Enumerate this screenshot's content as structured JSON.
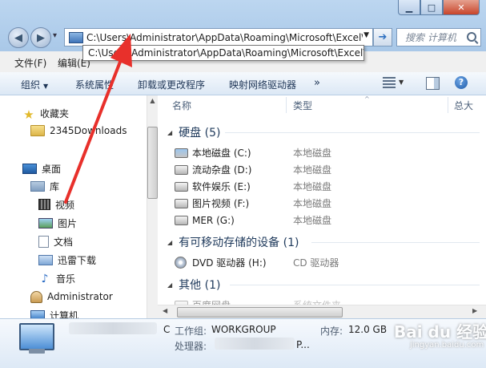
{
  "window": {
    "minimize_glyph": "▁",
    "maximize_glyph": "□",
    "close_glyph": "✕"
  },
  "nav": {
    "back_glyph": "◀",
    "forward_glyph": "▶",
    "recent_glyph": "▾"
  },
  "address": {
    "path": "C:\\Users\\Administrator\\AppData\\Roaming\\Microsoft\\Excel\\",
    "tooltip": "C:\\Users\\Administrator\\AppData\\Roaming\\Microsoft\\Excel\\",
    "dropdown_glyph": "▼",
    "go_glyph": "➔"
  },
  "search": {
    "placeholder": "搜索 计算机"
  },
  "menu": {
    "file": "文件(F)",
    "edit": "编辑(E)"
  },
  "toolbar": {
    "organize": "组织",
    "system_properties": "系统属性",
    "uninstall": "卸载或更改程序",
    "map_drive": "映射网络驱动器",
    "more": "»",
    "caret": "▼",
    "help_glyph": "?"
  },
  "sidebar": {
    "items": [
      {
        "label": "收藏夹",
        "icon": "star-icon"
      },
      {
        "label": "2345Downloads",
        "icon": "folder-icon"
      },
      {
        "label": "桌面",
        "icon": "desktop-icon"
      },
      {
        "label": "库",
        "icon": "library-icon"
      },
      {
        "label": "视频",
        "icon": "video-icon"
      },
      {
        "label": "图片",
        "icon": "picture-icon"
      },
      {
        "label": "文档",
        "icon": "document-icon"
      },
      {
        "label": "迅雷下载",
        "icon": "download-icon"
      },
      {
        "label": "音乐",
        "icon": "music-icon"
      },
      {
        "label": "Administrator",
        "icon": "user-icon"
      },
      {
        "label": "计算机",
        "icon": "computer-icon"
      }
    ],
    "music_glyph": "♪",
    "star_glyph": "★"
  },
  "columns": {
    "name": "名称",
    "type": "类型",
    "total": "总大"
  },
  "groups": {
    "hdd": {
      "title": "硬盘 (5)"
    },
    "removable": {
      "title": "有可移动存储的设备 (1)"
    },
    "other": {
      "title": "其他 (1)"
    },
    "tri": "◢"
  },
  "drives": [
    {
      "name": "本地磁盘 (C:)",
      "type": "本地磁盘"
    },
    {
      "name": "流动杂盘 (D:)",
      "type": "本地磁盘"
    },
    {
      "name": "软件娱乐 (E:)",
      "type": "本地磁盘"
    },
    {
      "name": "图片视频 (F:)",
      "type": "本地磁盘"
    },
    {
      "name": "MER (G:)",
      "type": "本地磁盘"
    }
  ],
  "removable": [
    {
      "name": "DVD 驱动器 (H:)",
      "type": "CD 驱动器"
    }
  ],
  "other": [
    {
      "name": "百度网盘",
      "type": "系统文件夹"
    }
  ],
  "details": {
    "workgroup_label": "工作组:",
    "workgroup_value": "WORKGROUP",
    "memory_label": "内存:",
    "memory_value": "12.0 GB",
    "processor_label": "处理器:",
    "processor_tail": "P...",
    "c_fragment": "C"
  },
  "watermark": {
    "text": "Bai du 经验",
    "sub": "jingyan.baidu.com"
  },
  "colors": {
    "arrow": "#e8302b",
    "accent": "#2d6fc0"
  }
}
